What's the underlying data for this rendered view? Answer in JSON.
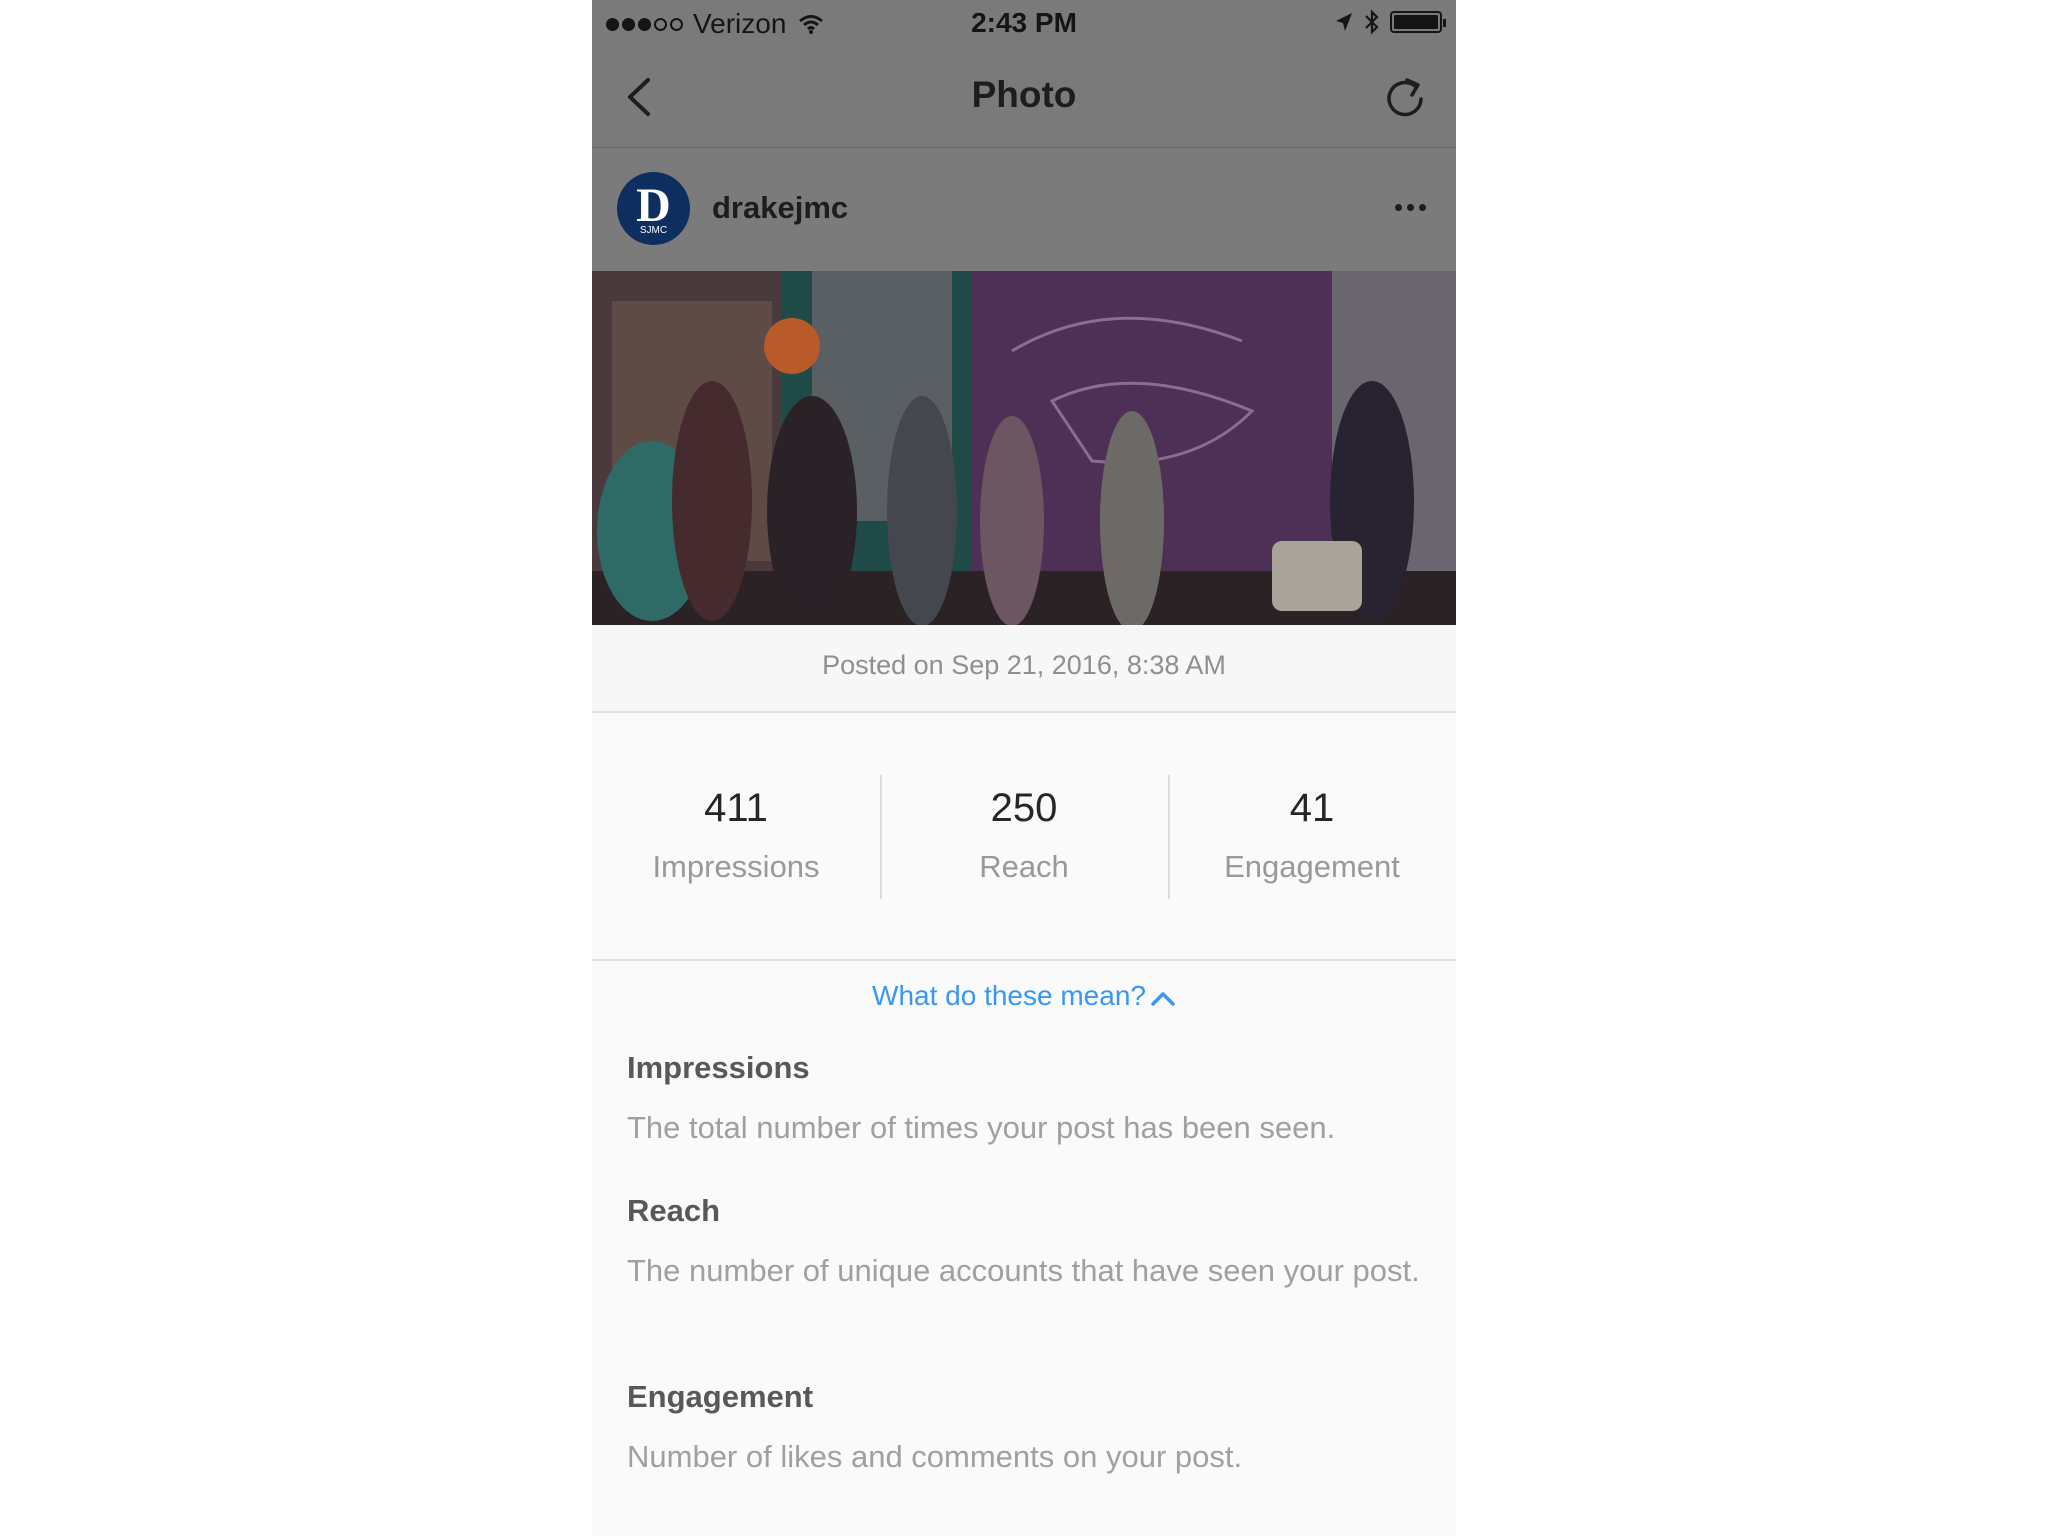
{
  "status_bar": {
    "carrier": "Verizon",
    "time": "2:43 PM",
    "signal_full": 3,
    "signal_empty": 2,
    "battery_level": 1.0
  },
  "nav": {
    "title": "Photo",
    "back_icon": "chevron-left-icon",
    "refresh_icon": "refresh-icon"
  },
  "post": {
    "username": "drakejmc",
    "avatar_letter": "D",
    "avatar_sub": "SJMC",
    "posted": "Posted on Sep 21, 2016, 8:38 AM"
  },
  "stats": [
    {
      "value": "411",
      "label": "Impressions"
    },
    {
      "value": "250",
      "label": "Reach"
    },
    {
      "value": "41",
      "label": "Engagement"
    }
  ],
  "help": {
    "toggle_label": "What do these mean?",
    "definitions": [
      {
        "title": "Impressions",
        "text": "The total number of times your post has been seen."
      },
      {
        "title": "Reach",
        "text": "The number of unique accounts that have seen your post."
      },
      {
        "title": "Engagement",
        "text": "Number of likes and comments on your post."
      }
    ]
  },
  "colors": {
    "dim_overlay": "#7a7a7a",
    "link": "#3897f0",
    "avatar_bg": "#0d2e5f"
  }
}
